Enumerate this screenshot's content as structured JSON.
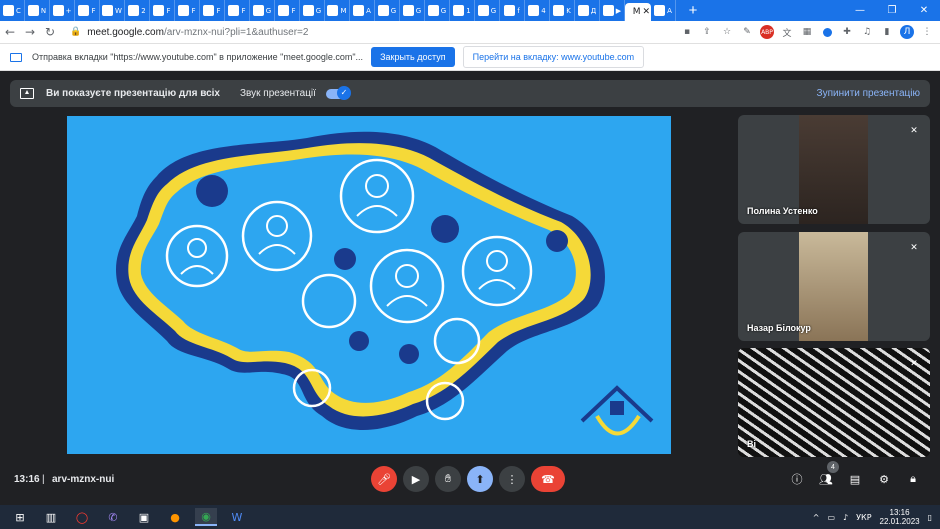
{
  "browser": {
    "tabs": [
      {
        "glyph": "C"
      },
      {
        "glyph": "N"
      },
      {
        "glyph": "+"
      },
      {
        "glyph": "F"
      },
      {
        "glyph": "W"
      },
      {
        "glyph": "2"
      },
      {
        "glyph": "F"
      },
      {
        "glyph": "F"
      },
      {
        "glyph": "F"
      },
      {
        "glyph": "F"
      },
      {
        "glyph": "G"
      },
      {
        "glyph": "F"
      },
      {
        "glyph": "G"
      },
      {
        "glyph": "M"
      },
      {
        "glyph": "A"
      },
      {
        "glyph": "G"
      },
      {
        "glyph": "G"
      },
      {
        "glyph": "G"
      },
      {
        "glyph": "1"
      },
      {
        "glyph": "G"
      },
      {
        "glyph": "f"
      },
      {
        "glyph": "4"
      },
      {
        "glyph": "K"
      },
      {
        "glyph": "Д"
      },
      {
        "glyph": "▶"
      },
      {
        "glyph": "M",
        "active": true,
        "close": "✕"
      },
      {
        "glyph": "A"
      }
    ],
    "new_tab": "+",
    "window_controls": {
      "minimize": "—",
      "maximize": "❐",
      "close": "✕"
    },
    "url": {
      "host": "meet.google.com",
      "path": "/arv-mznx-nui?pli=1&authuser=2"
    },
    "profile_initial": "Л"
  },
  "infobar": {
    "message": "Отправка вкладки \"https://www.youtube.com\" в приложение \"meet.google.com\"...",
    "share_button": "Закрыть доступ",
    "switch_button": "Перейти на вкладку: www.youtube.com"
  },
  "meet": {
    "presenting_label": "Ви показуєте презентацію для всіх",
    "audio_label": "Звук презентації",
    "stop_label": "Зупинити презентацію",
    "participants": [
      {
        "name": "Полина Устенко"
      },
      {
        "name": "Назар Білокур"
      },
      {
        "name": "Ві"
      }
    ],
    "clock": "13:16",
    "separator": "|",
    "meeting_code": "arv-mznx-nui",
    "people_count": "4",
    "colors": {
      "accent": "#1a73e8",
      "end_call": "#ea4335",
      "slide_bg": "#2da6f0",
      "map_yellow": "#f5d938",
      "map_navy": "#1a3a8c"
    }
  },
  "taskbar": {
    "language": "УКР",
    "time": "13:16",
    "date": "22.01.2023"
  }
}
